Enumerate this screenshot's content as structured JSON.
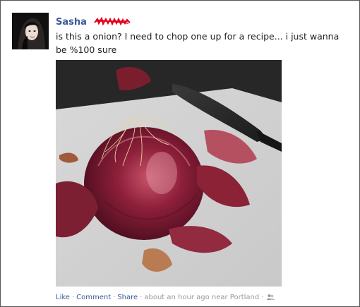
{
  "post": {
    "author": "Sasha",
    "text": "is this a onion? I need to chop one up for a recipe... i just wanna be %100 sure"
  },
  "footer": {
    "like_label": "Like",
    "comment_label": "Comment",
    "share_label": "Share",
    "timestamp": "about an hour ago near Portland",
    "privacy_icon": "friends-icon"
  },
  "colors": {
    "link": "#3b5998",
    "meta": "#999999",
    "redaction": "#e3001b"
  }
}
